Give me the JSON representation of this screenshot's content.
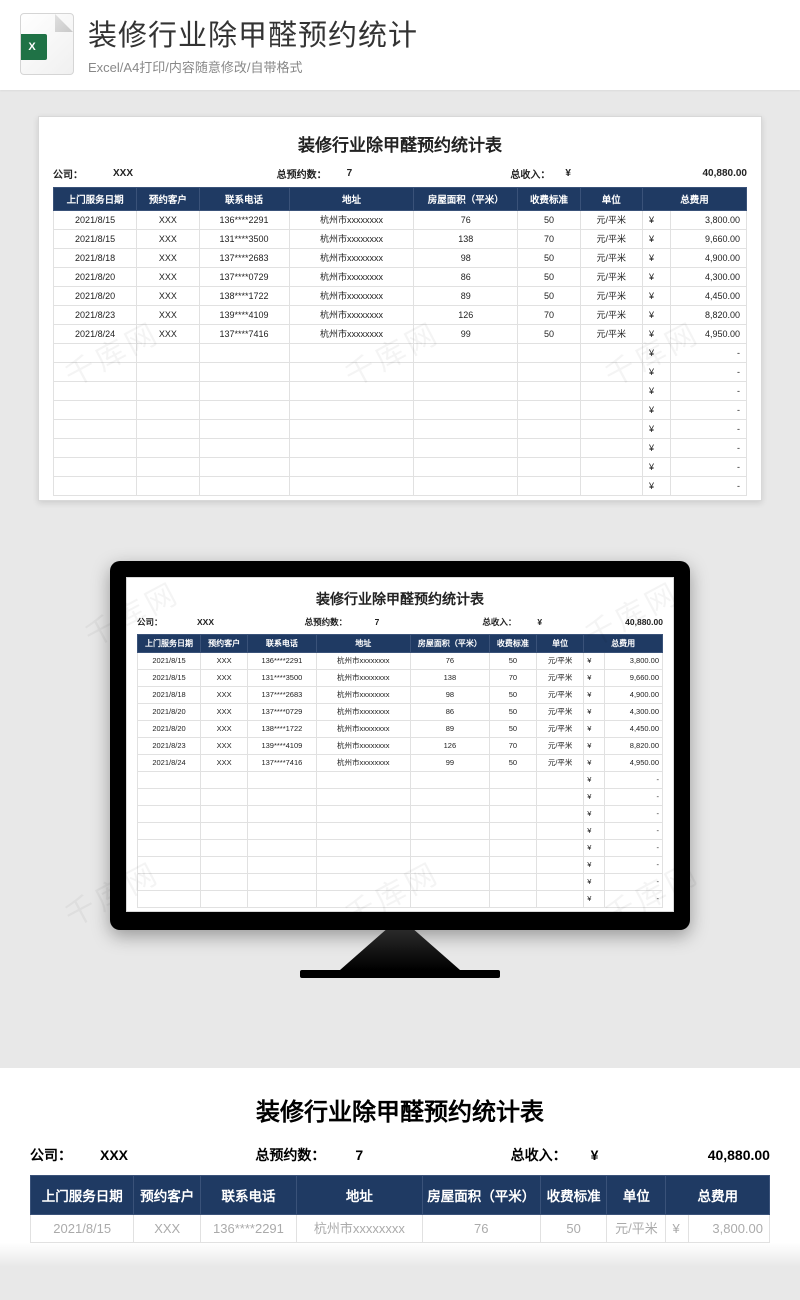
{
  "header": {
    "title": "装修行业除甲醛预约统计",
    "subtitle": "Excel/A4打印/内容随意修改/自带格式",
    "badge": "X"
  },
  "sheet": {
    "title": "装修行业除甲醛预约统计表",
    "sum": {
      "company_lbl": "公司：",
      "company": "XXX",
      "count_lbl": "总预约数：",
      "count": "7",
      "income_lbl": "总收入：",
      "cur": "¥",
      "income": "40,880.00"
    },
    "cols": [
      "上门服务日期",
      "预约客户",
      "联系电话",
      "地址",
      "房屋面积（平米）",
      "收费标准",
      "单位",
      "总费用"
    ],
    "rows": [
      {
        "d": "2021/8/15",
        "c": "XXX",
        "p": "136****2291",
        "a": "杭州市xxxxxxxx",
        "m": "76",
        "r": "50",
        "u": "元/平米",
        "y": "¥",
        "f": "3,800.00"
      },
      {
        "d": "2021/8/15",
        "c": "XXX",
        "p": "131****3500",
        "a": "杭州市xxxxxxxx",
        "m": "138",
        "r": "70",
        "u": "元/平米",
        "y": "¥",
        "f": "9,660.00"
      },
      {
        "d": "2021/8/18",
        "c": "XXX",
        "p": "137****2683",
        "a": "杭州市xxxxxxxx",
        "m": "98",
        "r": "50",
        "u": "元/平米",
        "y": "¥",
        "f": "4,900.00"
      },
      {
        "d": "2021/8/20",
        "c": "XXX",
        "p": "137****0729",
        "a": "杭州市xxxxxxxx",
        "m": "86",
        "r": "50",
        "u": "元/平米",
        "y": "¥",
        "f": "4,300.00"
      },
      {
        "d": "2021/8/20",
        "c": "XXX",
        "p": "138****1722",
        "a": "杭州市xxxxxxxx",
        "m": "89",
        "r": "50",
        "u": "元/平米",
        "y": "¥",
        "f": "4,450.00"
      },
      {
        "d": "2021/8/23",
        "c": "XXX",
        "p": "139****4109",
        "a": "杭州市xxxxxxxx",
        "m": "126",
        "r": "70",
        "u": "元/平米",
        "y": "¥",
        "f": "8,820.00"
      },
      {
        "d": "2021/8/24",
        "c": "XXX",
        "p": "137****7416",
        "a": "杭州市xxxxxxxx",
        "m": "99",
        "r": "50",
        "u": "元/平米",
        "y": "¥",
        "f": "4,950.00"
      }
    ],
    "empty": {
      "y": "¥",
      "f": "-",
      "count": 8
    }
  },
  "watermark": "千库网",
  "bottom_row": {
    "d": "2021/8/15",
    "c": "XXX",
    "p": "136****2291",
    "a": "杭州市xxxxxxxx",
    "m": "76",
    "r": "50",
    "u": "元/平米",
    "y": "¥",
    "f": "3,800.00"
  }
}
